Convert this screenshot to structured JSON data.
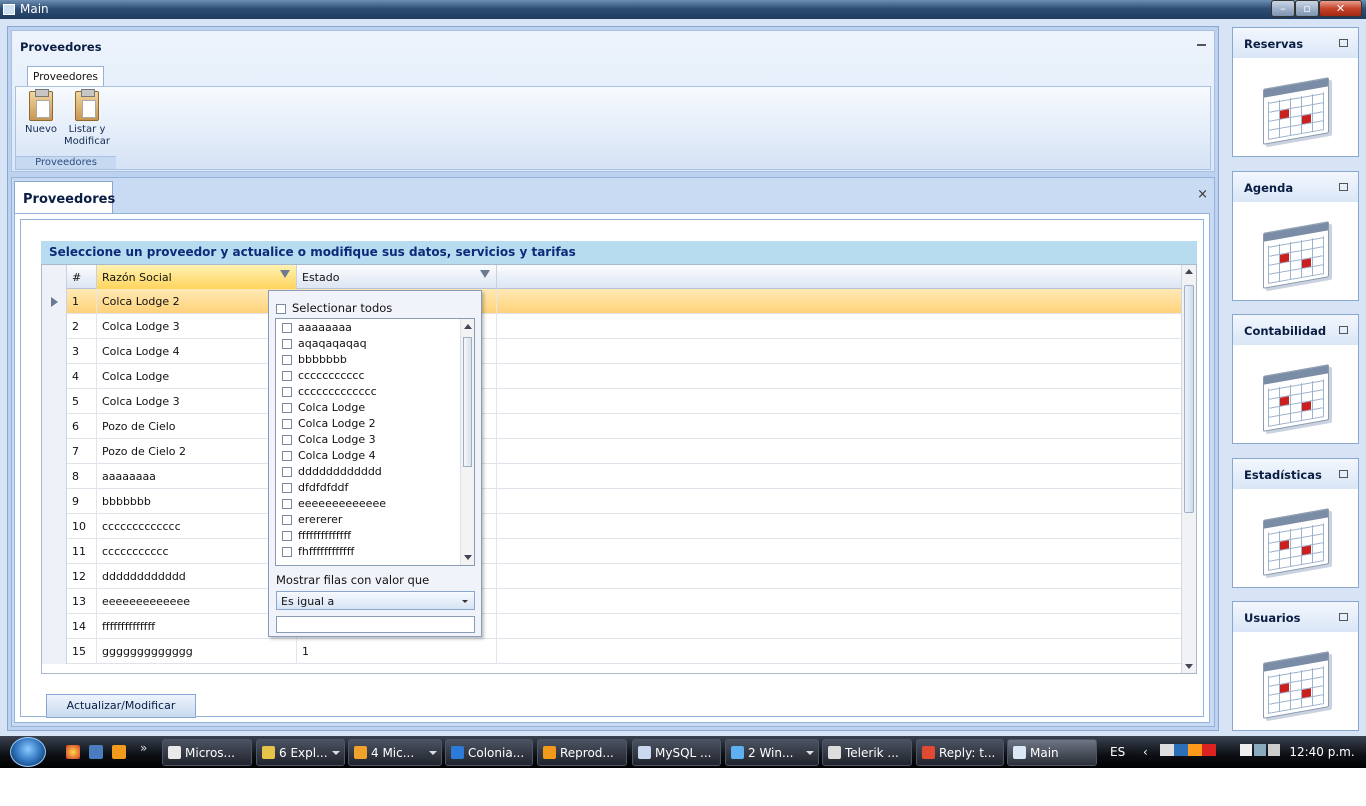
{
  "window": {
    "title": "Main"
  },
  "ribbon_pane": {
    "title": "Proveedores",
    "tab_label": "Proveedores",
    "buttons": [
      {
        "label_line1": "Nuevo",
        "label_line2": ""
      },
      {
        "label_line1": "Listar y",
        "label_line2": "Modificar"
      }
    ],
    "group_label": "Proveedores"
  },
  "document": {
    "tab_label": "Proveedores",
    "close_glyph": "×",
    "grid_title": "Seleccione un proveedor y actualice o modifique sus datos, servicios y tarifas",
    "columns": [
      "#",
      "Razón Social",
      "Estado"
    ],
    "rows": [
      {
        "num": "1",
        "name": "Colca Lodge 2",
        "estado": ""
      },
      {
        "num": "2",
        "name": "Colca Lodge 3",
        "estado": ""
      },
      {
        "num": "3",
        "name": "Colca Lodge 4",
        "estado": ""
      },
      {
        "num": "4",
        "name": "Colca Lodge",
        "estado": ""
      },
      {
        "num": "5",
        "name": "Colca Lodge 3",
        "estado": ""
      },
      {
        "num": "6",
        "name": "Pozo de Cielo",
        "estado": ""
      },
      {
        "num": "7",
        "name": "Pozo de Cielo 2",
        "estado": ""
      },
      {
        "num": "8",
        "name": "aaaaaaaa",
        "estado": ""
      },
      {
        "num": "9",
        "name": "bbbbbbb",
        "estado": ""
      },
      {
        "num": "10",
        "name": "ccccccccccccc",
        "estado": ""
      },
      {
        "num": "11",
        "name": "ccccccccccc",
        "estado": ""
      },
      {
        "num": "12",
        "name": "dddddddddddd",
        "estado": ""
      },
      {
        "num": "13",
        "name": "eeeeeeeeeeeee",
        "estado": ""
      },
      {
        "num": "14",
        "name": "ffffffffffffff",
        "estado": ""
      },
      {
        "num": "15",
        "name": "ggggggggggggg",
        "estado": "1"
      }
    ],
    "update_button": "Actualizar/Modificar"
  },
  "filter_popup": {
    "select_all": "Selectionar todos",
    "items": [
      "aaaaaaaa",
      "aqaqaqaqaq",
      "bbbbbbb",
      "ccccccccccc",
      "ccccccccccccc",
      "Colca Lodge",
      "Colca Lodge 2",
      "Colca Lodge 3",
      "Colca Lodge 4",
      "dddddddddddd",
      "dfdfdfddf",
      "eeeeeeeeeeeee",
      "erererer",
      "ffffffffffffff",
      "fhffffffffffff"
    ],
    "show_rows_label": "Mostrar  filas con valor que",
    "operator": "Es igual a",
    "value": ""
  },
  "side_panels": [
    "Reservas",
    "Agenda",
    "Contabilidad",
    "Estadísticas",
    "Usuarios"
  ],
  "taskbar": {
    "buttons": [
      "Micros...",
      "6 Expl...",
      "4 Mic...",
      "Colonia...",
      "Reprod...",
      "MySQL ...",
      "2 Win...",
      "Telerik ...",
      "Reply: t...",
      "Main"
    ],
    "language": "ES",
    "time": "12:40 p.m."
  }
}
